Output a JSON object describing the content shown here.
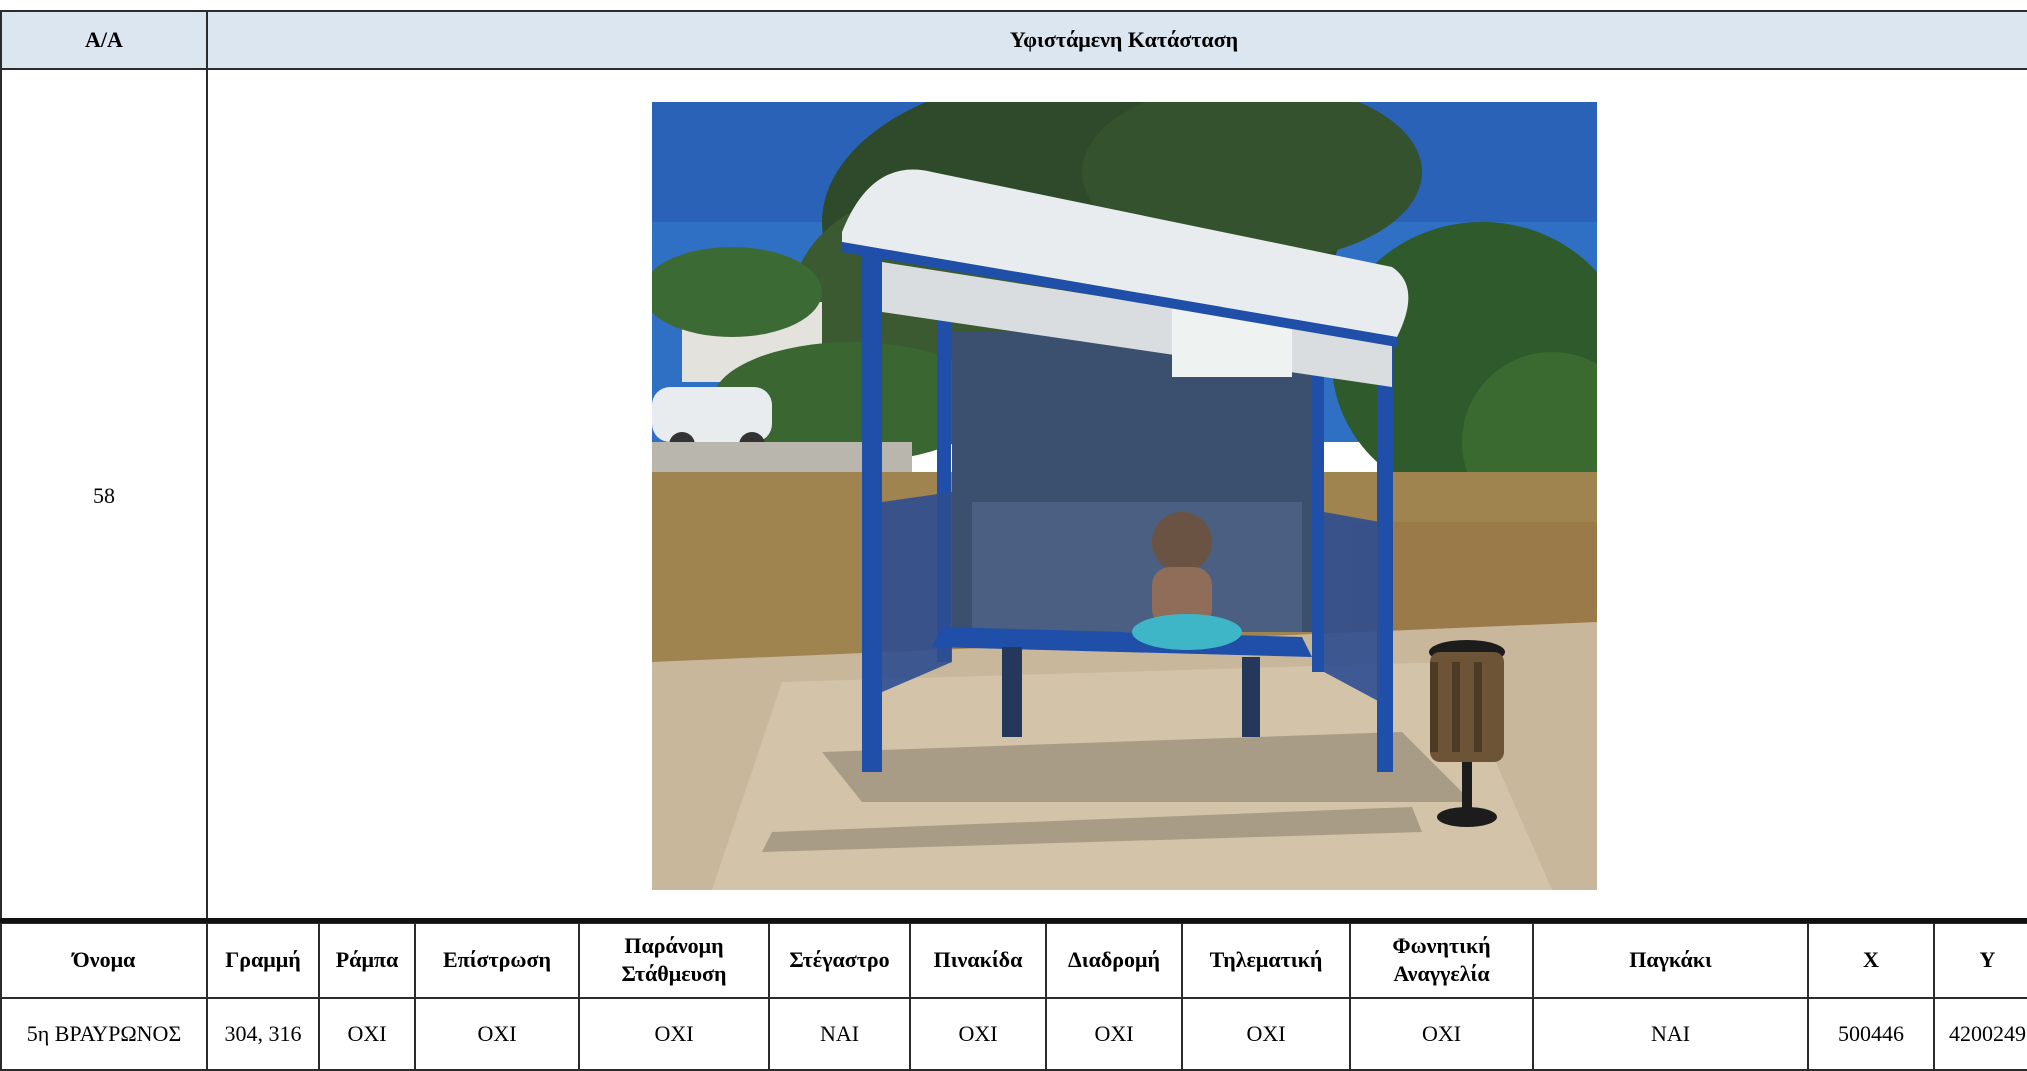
{
  "top_table": {
    "header_aa": "A/A",
    "header_status": "Υφιστάμενη Κατάσταση",
    "row_number": "58"
  },
  "photo": {
    "subject": "bus-stop-shelter",
    "colors": {
      "sky": "#2f6fc4",
      "shelter_frame": "#1f4fa8",
      "roof": "#e8ecef",
      "ground": "#c9b79c",
      "grass": "#a08450",
      "trees": "#2e4a2a"
    }
  },
  "bottom_table": {
    "headers": [
      "Όνομα",
      "Γραμμή",
      "Ράμπα",
      "Επίστρωση",
      "Παράνομη Στάθμευση",
      "Στέγαστρο",
      "Πινακίδα",
      "Διαδρομή",
      "Τηλεματική",
      "Φωνητική Αναγγελία",
      "Παγκάκι",
      "X",
      "Y"
    ],
    "values": [
      "5η ΒΡΑΥΡΩΝΟΣ",
      "304, 316",
      "OXI",
      "OXI",
      "OXI",
      "NAI",
      "OXI",
      "OXI",
      "OXI",
      "OXI",
      "NAI",
      "500446",
      "4200249"
    ]
  }
}
